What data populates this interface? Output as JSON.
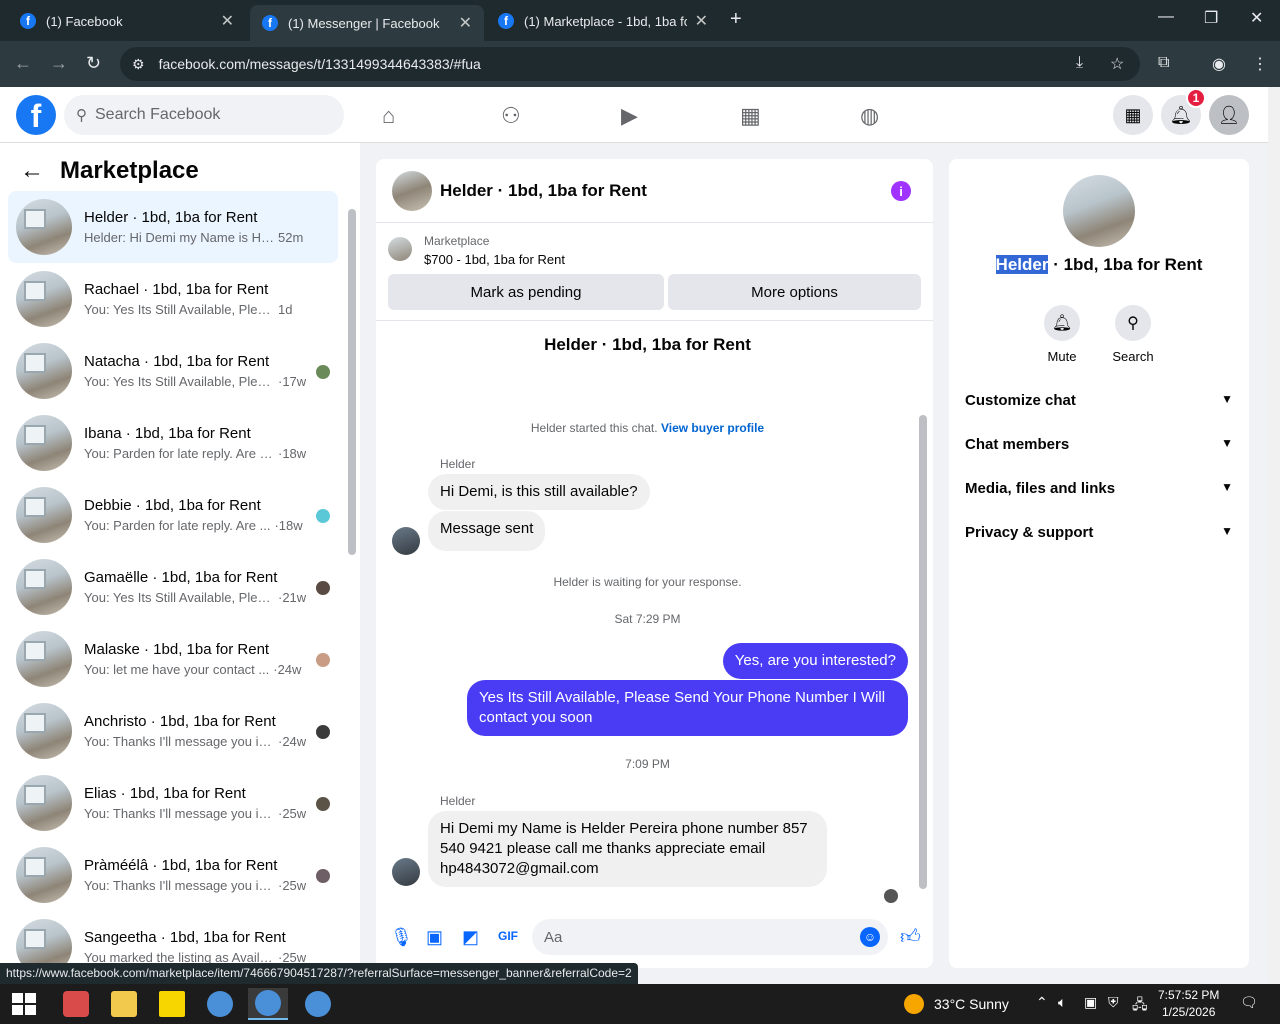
{
  "browser": {
    "tabs": [
      {
        "title": "(1) Facebook"
      },
      {
        "title": "(1) Messenger | Facebook"
      },
      {
        "title": "(1) Marketplace - 1bd, 1ba for R"
      }
    ],
    "url": "facebook.com/messages/t/1331499344643383/#fua",
    "status_url": "https://www.facebook.com/marketplace/item/746667904517287/?referralSurface=messenger_banner&referralCode=2"
  },
  "header": {
    "search_placeholder": "Search Facebook",
    "notification_count": "1"
  },
  "sidebar": {
    "title": "Marketplace",
    "conversations": [
      {
        "name": "Helder · 1bd, 1ba for Rent",
        "preview": "Helder: Hi Demi my Name is Held...",
        "time": "52m",
        "selected": true
      },
      {
        "name": "Rachael · 1bd, 1ba for Rent",
        "preview": "You: Yes Its Still Available, Please Se...",
        "time": "1d"
      },
      {
        "name": "Natacha · 1bd, 1ba for Rent",
        "preview": "You: Yes Its Still Available, Pleas...",
        "time": "·17w"
      },
      {
        "name": "Ibana · 1bd, 1ba for Rent",
        "preview": "You: Parden for late reply. Are yo...",
        "time": "·18w"
      },
      {
        "name": "Debbie · 1bd, 1ba for Rent",
        "preview": "You: Parden for late reply. Are ...",
        "time": "·18w"
      },
      {
        "name": "Gamaëlle · 1bd, 1ba for Rent",
        "preview": "You: Yes Its Still Available, Pleas...",
        "time": "·21w"
      },
      {
        "name": "Malaske · 1bd, 1ba for Rent",
        "preview": "You: let me have your contact ...",
        "time": "·24w"
      },
      {
        "name": "Anchristo · 1bd, 1ba for Rent",
        "preview": "You: Thanks I'll message you in...",
        "time": "·24w"
      },
      {
        "name": "Elias · 1bd, 1ba for Rent",
        "preview": "You: Thanks I'll message you in...",
        "time": "·25w"
      },
      {
        "name": "Pràméélâ · 1bd, 1ba for Rent",
        "preview": "You: Thanks I'll message you in...",
        "time": "·25w"
      },
      {
        "name": "Sangeetha · 1bd, 1ba for Rent",
        "preview": "You marked the listing as Available.",
        "time": "·25w"
      }
    ]
  },
  "chat": {
    "title": "Helder · 1bd, 1ba for Rent",
    "marketplace_label": "Marketplace",
    "listing": "$700 - 1bd, 1ba for Rent",
    "mark_pending": "Mark as pending",
    "more_options": "More options",
    "center_name": "Helder · 1bd, 1ba for Rent",
    "started_text": "Helder started this chat.",
    "view_profile": "View buyer profile",
    "sender": "Helder",
    "msg1": "Hi Demi, is this still available?",
    "msg2": "Message sent",
    "waiting": "Helder is waiting for your response.",
    "time1": "Sat 7:29 PM",
    "out1": "Yes, are you interested?",
    "out2": "Yes Its Still Available, Please Send Your Phone Number I Will contact you soon",
    "time2": "7:09 PM",
    "msg3": "Hi Demi my Name is Helder Pereira phone number 857 540 9421 please call me thanks appreciate email hp4843072@gmail.com",
    "composer_placeholder": "Aa"
  },
  "details": {
    "name_highlight": "Helder",
    "name_rest": " · 1bd, 1ba for Rent",
    "mute": "Mute",
    "search": "Search",
    "sections": [
      "Customize chat",
      "Chat members",
      "Media, files and links",
      "Privacy & support"
    ]
  },
  "taskbar": {
    "weather": "33°C  Sunny",
    "time": "7:57:52 PM",
    "date": "1/25/2026"
  },
  "colors": {
    "facebook_blue": "#1877f2",
    "outgoing_bubble": "#4a3cf5",
    "info_purple": "#a033ff"
  }
}
